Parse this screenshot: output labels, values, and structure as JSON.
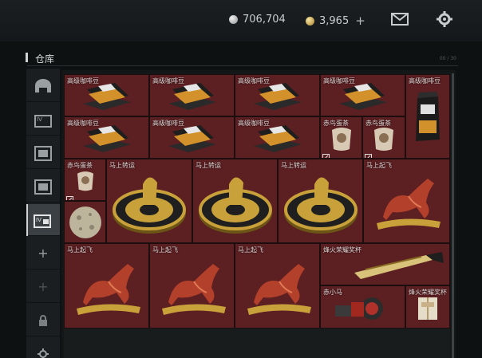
{
  "currency": {
    "silver_value": "706,704",
    "gold_value": "3,965",
    "gold_add": "+"
  },
  "icons": {
    "mail": "mail-icon",
    "settings": "gear-icon"
  },
  "warehouse": {
    "title": "仓库",
    "corner_text": "00 / 30"
  },
  "sidebar": {
    "tabs": [
      {
        "icon": "helmet-icon"
      },
      {
        "icon": "tv-crate-icon"
      },
      {
        "icon": "image-crate-icon"
      },
      {
        "icon": "image-crate-icon-2"
      },
      {
        "icon": "tv-crate-icon-active"
      },
      {
        "icon": "add-icon",
        "text": "+"
      },
      {
        "icon": "add-icon-dim",
        "text": "+"
      },
      {
        "icon": "lock-icon"
      },
      {
        "icon": "gear-icon"
      }
    ]
  },
  "items": {
    "coffee_label": "高级咖啡豆",
    "bird_label": "赤鸟蛋茶",
    "lucky_label": "赤鸟蛋茶",
    "wheel_label": "马上转运",
    "horse_label": "马上起飞",
    "cup_label": "烽火荣耀奖杯",
    "red_horse_label": "赤小马",
    "box_label": "烽火荣耀奖杯"
  },
  "colors": {
    "cell_bg": "#5c1f22",
    "gold": "#c9a13a"
  }
}
